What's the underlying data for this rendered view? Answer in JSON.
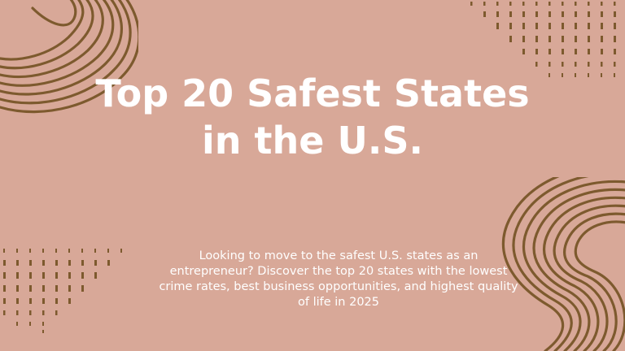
{
  "slide": {
    "title_line1": "Top 20 Safest States",
    "title_line2": "in the U.S.",
    "subtitle": "Looking to move to the safest U.S. states as an entrepreneur? Discover the top 20 states with the lowest crime rates, best business opportunities, and highest quality of life in 2025"
  },
  "colors": {
    "background": "#d8a898",
    "accent": "#7d5a2e",
    "text": "#ffffff"
  },
  "decorations": [
    "concentric-arc-top-left",
    "dot-grid-top-right",
    "dot-grid-bottom-left",
    "concentric-arc-bottom-right"
  ]
}
